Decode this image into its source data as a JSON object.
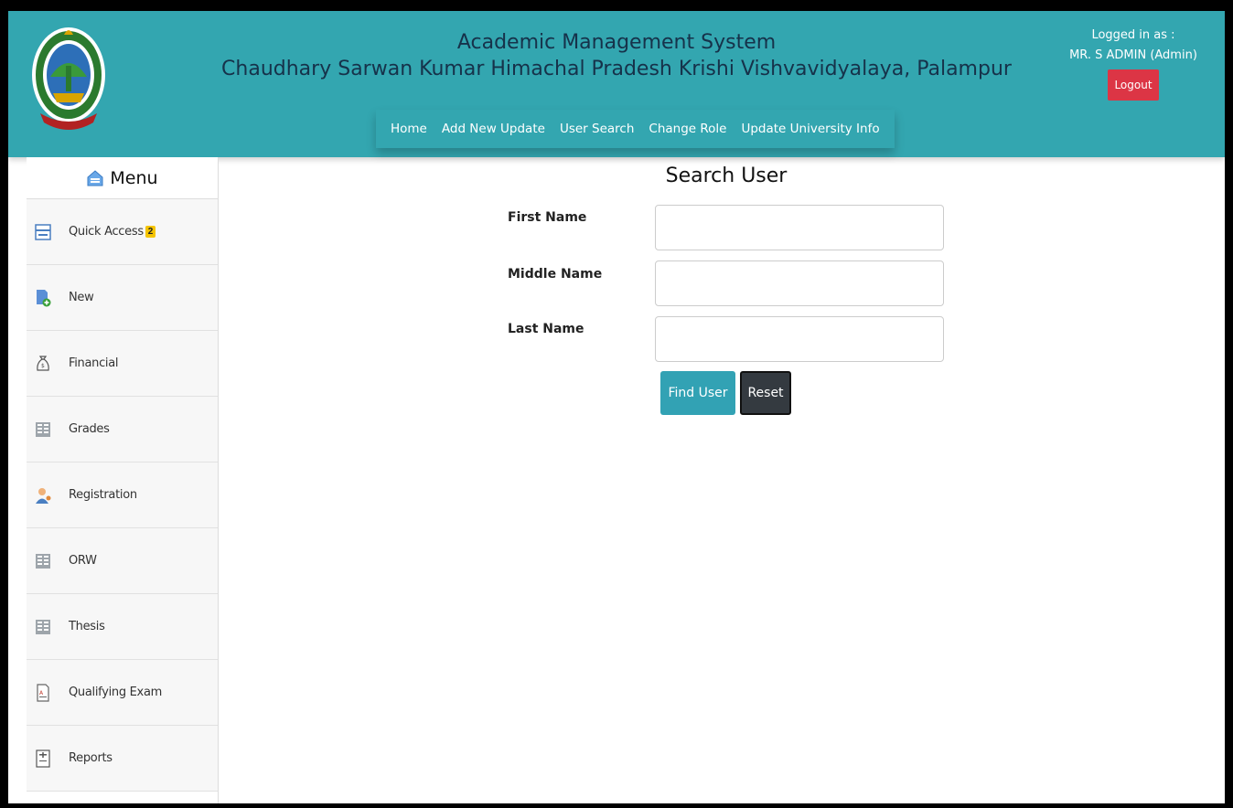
{
  "header": {
    "title_line1": "Academic Management System",
    "title_line2": "Chaudhary Sarwan Kumar Himachal Pradesh Krishi Vishvavidyalaya, Palampur",
    "logged_in_label": "Logged in as :",
    "user_name": "MR. S ADMIN (Admin)",
    "logout_label": "Logout",
    "accent_color": "#33a6b0"
  },
  "topnav": {
    "items": [
      {
        "label": "Home"
      },
      {
        "label": "Add New Update"
      },
      {
        "label": "User Search"
      },
      {
        "label": "Change Role"
      },
      {
        "label": "Update University Info"
      }
    ]
  },
  "sidebar": {
    "title": "Menu",
    "items": [
      {
        "label": "Quick Access",
        "badge": "2",
        "icon": "quick-access-icon"
      },
      {
        "label": "New",
        "icon": "new-document-icon"
      },
      {
        "label": "Financial",
        "icon": "money-bag-icon"
      },
      {
        "label": "Grades",
        "icon": "grid-icon"
      },
      {
        "label": "Registration",
        "icon": "user-icon"
      },
      {
        "label": "ORW",
        "icon": "grid-icon"
      },
      {
        "label": "Thesis",
        "icon": "grid-icon"
      },
      {
        "label": "Qualifying Exam",
        "icon": "exam-icon"
      },
      {
        "label": "Reports",
        "icon": "report-icon"
      }
    ]
  },
  "main": {
    "title": "Search User",
    "fields": [
      {
        "label": "First Name",
        "value": ""
      },
      {
        "label": "Middle Name",
        "value": ""
      },
      {
        "label": "Last Name",
        "value": ""
      }
    ],
    "find_label": "Find User",
    "reset_label": "Reset"
  }
}
